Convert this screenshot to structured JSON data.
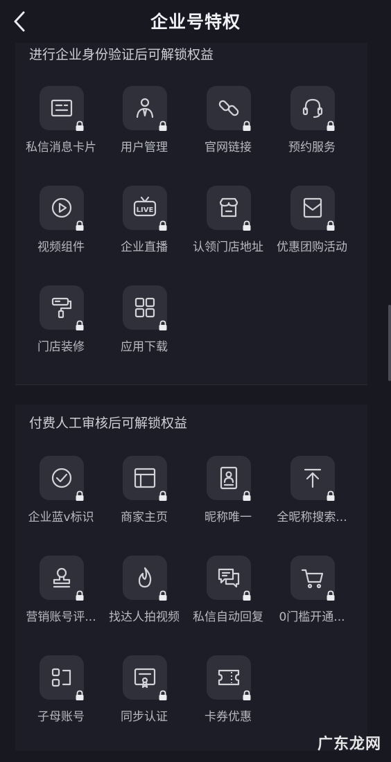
{
  "header": {
    "title": "企业号特权"
  },
  "sections": [
    {
      "title": "进行企业身份验证后可解锁权益",
      "items": [
        {
          "label": "私信消息卡片",
          "icon": "card-icon"
        },
        {
          "label": "用户管理",
          "icon": "person-tie-icon"
        },
        {
          "label": "官网链接",
          "icon": "link-icon"
        },
        {
          "label": "预约服务",
          "icon": "headset-icon"
        },
        {
          "label": "视频组件",
          "icon": "play-circle-icon"
        },
        {
          "label": "企业直播",
          "icon": "live-tv-icon"
        },
        {
          "label": "认领门店地址",
          "icon": "store-icon"
        },
        {
          "label": "优惠团购活动",
          "icon": "coupon-envelope-icon"
        },
        {
          "label": "门店装修",
          "icon": "paint-roller-icon"
        },
        {
          "label": "应用下载",
          "icon": "app-grid-icon"
        }
      ]
    },
    {
      "title": "付费人工审核后可解锁权益",
      "items": [
        {
          "label": "企业蓝v标识",
          "icon": "check-circle-icon"
        },
        {
          "label": "商家主页",
          "icon": "layout-icon"
        },
        {
          "label": "昵称唯一",
          "icon": "id-badge-icon"
        },
        {
          "label": "全昵称搜索...",
          "icon": "upload-top-icon"
        },
        {
          "label": "营销账号评...",
          "icon": "stamp-icon"
        },
        {
          "label": "找达人拍视频",
          "icon": "flame-icon"
        },
        {
          "label": "私信自动回复",
          "icon": "chat-bubbles-icon"
        },
        {
          "label": "0门槛开通...",
          "icon": "cart-icon"
        },
        {
          "label": "子母账号",
          "icon": "sub-accounts-icon"
        },
        {
          "label": "同步认证",
          "icon": "certificate-icon"
        },
        {
          "label": "卡券优惠",
          "icon": "ticket-icon"
        }
      ]
    }
  ],
  "watermark": "广东龙网"
}
